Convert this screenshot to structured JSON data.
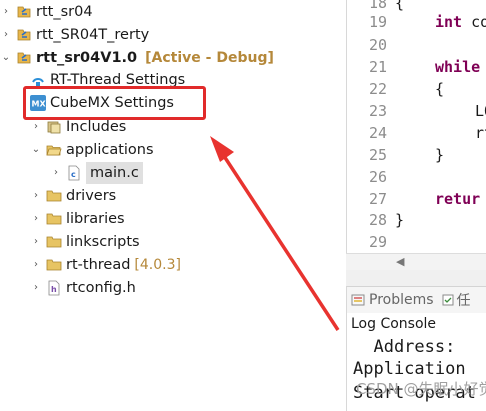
{
  "project_tree": {
    "items": [
      {
        "label": "rtt_sr04"
      },
      {
        "label": "rtt_SR04T_rerty"
      },
      {
        "label": "rtt_sr04V1.0",
        "decoration": "[Active - Debug]"
      },
      {
        "label": "RT-Thread Settings"
      },
      {
        "label": "CubeMX Settings"
      },
      {
        "label": "Includes"
      },
      {
        "label": "applications"
      },
      {
        "label": "main.c"
      },
      {
        "label": "drivers"
      },
      {
        "label": "libraries"
      },
      {
        "label": "linkscripts"
      },
      {
        "label": "rt-thread",
        "decoration": "[4.0.3]"
      },
      {
        "label": "rtconfig.h"
      }
    ]
  },
  "editor": {
    "lines": [
      {
        "num": "18",
        "text": "{"
      },
      {
        "num": "19",
        "kw": "int",
        "text": " co"
      },
      {
        "num": "20",
        "text": ""
      },
      {
        "num": "21",
        "kw": "while",
        "text": ""
      },
      {
        "num": "22",
        "text": "{"
      },
      {
        "num": "23",
        "text": "LO"
      },
      {
        "num": "24",
        "text": "rt"
      },
      {
        "num": "25",
        "text": "}"
      },
      {
        "num": "26",
        "text": ""
      },
      {
        "num": "27",
        "kw": "retur",
        "text": ""
      },
      {
        "num": "28",
        "text": "}"
      },
      {
        "num": "29",
        "text": ""
      }
    ]
  },
  "bottom_panel": {
    "tabs": [
      {
        "label": "Problems"
      },
      {
        "label": "任"
      }
    ],
    "console_title": "Log Console",
    "console_lines": [
      "  Address:",
      "Application",
      "Start operat"
    ]
  },
  "watermark": "CSDN @失眠小好觉",
  "colors": {
    "highlight": "#e12a2a",
    "keyword": "#7f0055",
    "decoration": "#b5883a"
  }
}
